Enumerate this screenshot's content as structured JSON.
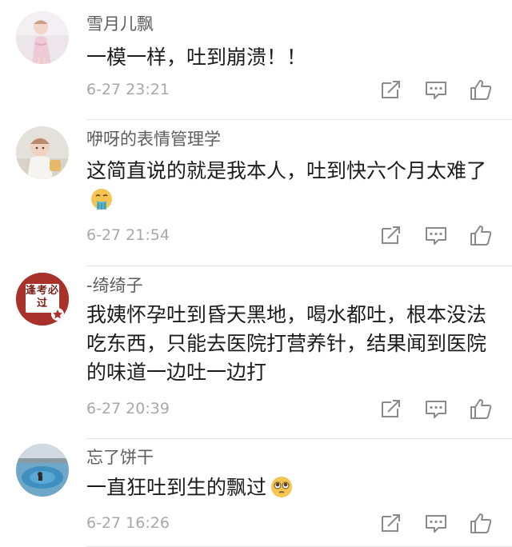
{
  "comments": [
    {
      "username": "雪月儿飘",
      "content": "一模一样，吐到崩溃！！",
      "time": "6-27 23:21",
      "avatar_icon": "girl-baby-avatar",
      "emoji_icon": ""
    },
    {
      "username": "咿呀的表情管理学",
      "content": "这简直说的就是我本人，吐到快六个月太难了",
      "time": "6-27 21:54",
      "avatar_icon": "baby-avatar",
      "emoji_icon": "vomiting-face-emoji"
    },
    {
      "username": "-绮绮子",
      "content": "我姨怀孕吐到昏天黑地，喝水都吐，根本没法吃东西，只能去医院打营养针，结果闻到医院的味道一边吐一边打",
      "time": "6-27 20:39",
      "avatar_icon": "badge-avatar",
      "avatar_badge_text": "逢考必过",
      "emoji_icon": ""
    },
    {
      "username": "忘了饼干",
      "content": "一直狂吐到生的飘过",
      "time": "6-27 16:26",
      "avatar_icon": "pool-avatar",
      "emoji_icon": "pleading-face-emoji"
    }
  ],
  "actions": {
    "share_icon": "share-icon",
    "comment_icon": "comment-icon",
    "like_icon": "thumbs-up-icon"
  },
  "colors": {
    "username": "#5d5d5d",
    "content": "#1c1c1c",
    "time": "#a8a8a8",
    "icon": "#8a8a8a",
    "divider": "#e6e6e6",
    "badge_red": "#a8322b"
  }
}
